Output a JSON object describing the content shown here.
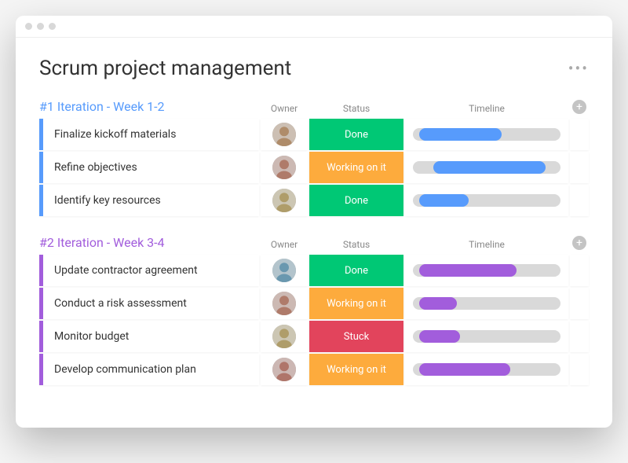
{
  "page": {
    "title": "Scrum project management"
  },
  "columns": {
    "owner": "Owner",
    "status": "Status",
    "timeline": "Timeline"
  },
  "status_colors": {
    "Done": "#00c875",
    "Working on it": "#fdab3d",
    "Stuck": "#e2445c"
  },
  "groups": [
    {
      "title": "#1 Iteration - Week 1-2",
      "accent": "#579bfc",
      "rows": [
        {
          "task": "Finalize kickoff materials",
          "owner": "person-1",
          "status": "Done",
          "timeline": {
            "start": 4,
            "end": 60
          }
        },
        {
          "task": "Refine objectives",
          "owner": "person-2",
          "status": "Working on it",
          "timeline": {
            "start": 14,
            "end": 90
          }
        },
        {
          "task": "Identify key resources",
          "owner": "person-3",
          "status": "Done",
          "timeline": {
            "start": 4,
            "end": 38
          }
        }
      ]
    },
    {
      "title": "#2 Iteration - Week 3-4",
      "accent": "#a25ddc",
      "rows": [
        {
          "task": "Update contractor agreement",
          "owner": "person-4",
          "status": "Done",
          "timeline": {
            "start": 4,
            "end": 70
          }
        },
        {
          "task": "Conduct a risk assessment",
          "owner": "person-2",
          "status": "Working on it",
          "timeline": {
            "start": 4,
            "end": 30
          }
        },
        {
          "task": "Monitor budget",
          "owner": "person-3",
          "status": "Stuck",
          "timeline": {
            "start": 4,
            "end": 32
          }
        },
        {
          "task": "Develop communication plan",
          "owner": "person-5",
          "status": "Working on it",
          "timeline": {
            "start": 4,
            "end": 66
          }
        }
      ]
    }
  ]
}
